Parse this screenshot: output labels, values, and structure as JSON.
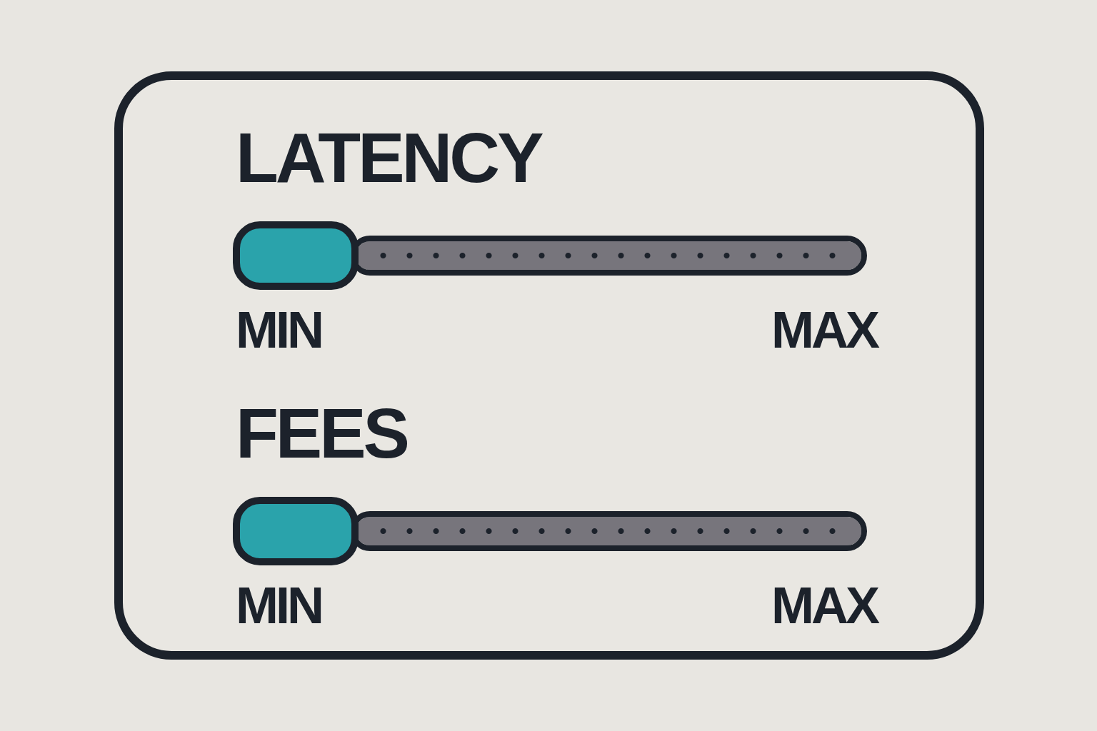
{
  "sliders": [
    {
      "label": "LATENCY",
      "level": 0,
      "min_label": "MIN",
      "max_label": "MAX"
    },
    {
      "label": "FEES",
      "level": 0,
      "min_label": "MIN",
      "max_label": "MAX"
    }
  ]
}
